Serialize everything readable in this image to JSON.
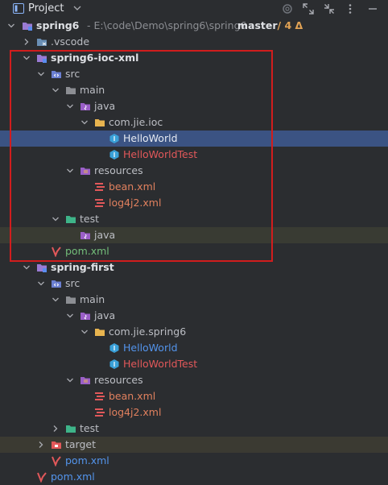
{
  "header": {
    "title": "Project",
    "colors": {
      "bg": "#2b2d30",
      "text": "#dfe1e5"
    }
  },
  "tree": {
    "root": {
      "name": "spring6",
      "path": "E:\\code\\Demo\\spring6\\spring6",
      "branch": "master",
      "changes": "/ 4 Δ"
    },
    "vscode": ".vscode",
    "m1": {
      "name": "spring6-ioc-xml",
      "src": "src",
      "main": "main",
      "java": "java",
      "pkg": "com.jie.ioc",
      "cls1": "HelloWorld",
      "cls2": "HelloWorldTest",
      "resources": "resources",
      "res1": "bean.xml",
      "res2": "log4j2.xml",
      "test": "test",
      "test_java": "java",
      "pom": "pom.xml"
    },
    "m2": {
      "name": "spring-first",
      "src": "src",
      "main": "main",
      "java": "java",
      "pkg": "com.jie.spring6",
      "cls1": "HelloWorld",
      "cls2": "HelloWorldTest",
      "resources": "resources",
      "res1": "bean.xml",
      "res2": "log4j2.xml",
      "test": "test",
      "target": "target",
      "pom": "pom.xml"
    },
    "root_pom": "pom.xml"
  },
  "colors": {
    "selected_row": "#3b5383",
    "annotation_box": "#d11d1d",
    "java_class": "#5394ec",
    "test_class": "#e2585a",
    "xml_file": "#e0805e",
    "test_root": "#73bd79"
  }
}
